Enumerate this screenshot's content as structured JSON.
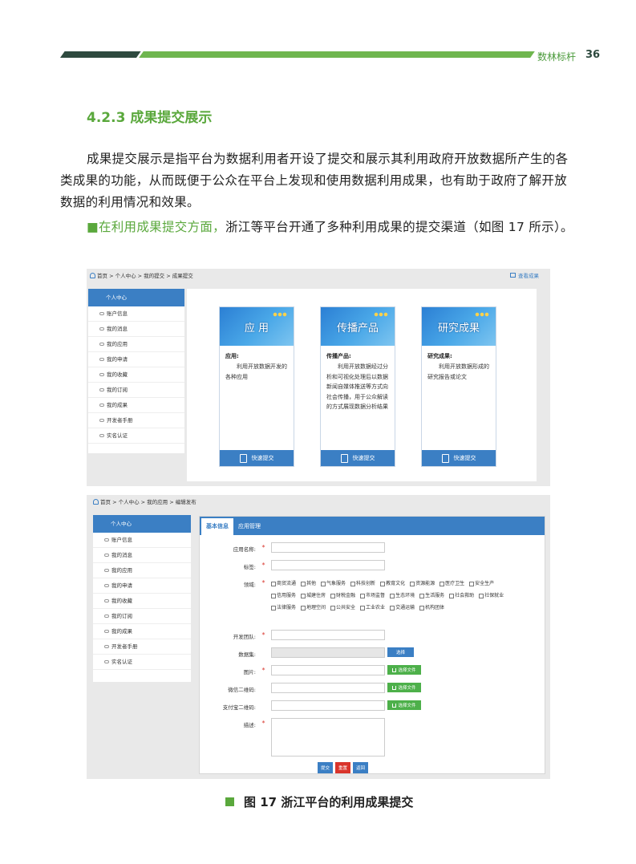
{
  "header": {
    "title": "数林标杆",
    "page_number": "36"
  },
  "section_title": "4.2.3 成果提交展示",
  "paragraphs": {
    "p1": "成果提交展示是指平台为数据利用者开设了提交和展示其利用政府开放数据所产生的各类成果的功能，从而既便于公众在平台上发现和使用数据利用成果，也有助于政府了解开放数据的利用情况和效果。",
    "p2_bullet": "■",
    "p2_highlight": "在利用成果提交方面，",
    "p2_rest": "浙江等平台开通了多种利用成果的提交渠道（如图 17 所示）。"
  },
  "shot1": {
    "breadcrumb": "首页 > 个人中心 > 我的提交 > 成果提交",
    "view_results": "查看成果",
    "sidebar": {
      "head": "个人中心",
      "items": [
        "账户信息",
        "我的消息",
        "我的应用",
        "我的申请",
        "我的收藏",
        "我的订阅",
        "我的成果",
        "开发者手册",
        "实名认证"
      ]
    },
    "cards": [
      {
        "banner": "应 用",
        "title": "应用:",
        "desc": "利用开放数据开发的各种应用",
        "button": "快速提交"
      },
      {
        "banner": "传播产品",
        "title": "传播产品:",
        "desc": "利用开放数据经过分析和可视化处理后以数据新闻自媒体推送等方式向社会传播，用于公众解读的方式展现数据分析结果",
        "button": "快速提交"
      },
      {
        "banner": "研究成果",
        "title": "研究成果:",
        "desc": "利用开放数据形成的研究报告或论文",
        "button": "快速提交"
      }
    ]
  },
  "shot2": {
    "breadcrumb": "首页 > 个人中心 > 我的应用 > 编辑发布",
    "sidebar": {
      "head": "个人中心",
      "items": [
        "账户信息",
        "我的消息",
        "我的应用",
        "我的申请",
        "我的收藏",
        "我的订阅",
        "我的成果",
        "开发者手册",
        "实名认证"
      ]
    },
    "tabs": [
      "基本信息",
      "应用管理"
    ],
    "required_mark": "*",
    "form": {
      "app_name": "应用名称:",
      "tags": "标签:",
      "domain": "领域:",
      "team": "开发团队:",
      "dataset": "数据集:",
      "image": "图片:",
      "wechat_qr": "微信二维码:",
      "alipay_qr": "支付宝二维码:",
      "description": "描述:"
    },
    "domain_options": [
      "商贸流通",
      "其他",
      "气象服务",
      "科技创新",
      "教育文化",
      "资源能源",
      "医疗卫生",
      "安全生产",
      "信用服务",
      "城建住房",
      "财税金融",
      "市场监督",
      "生态环境",
      "生活服务",
      "社会救助",
      "社保就业",
      "法律服务",
      "地理空间",
      "公共安全",
      "工业农业",
      "交通运输",
      "机构团体"
    ],
    "select_label": "选择",
    "upload_label": "选择文件",
    "actions": [
      "提交",
      "重置",
      "返回"
    ]
  },
  "caption": "图 17 浙江平台的利用成果提交",
  "colors": {
    "brand_green": "#5aa83c",
    "dark_band": "#2e4a3f",
    "ui_blue": "#3b7fc4",
    "required_red": "#d9342b",
    "upload_green": "#4db04a"
  }
}
